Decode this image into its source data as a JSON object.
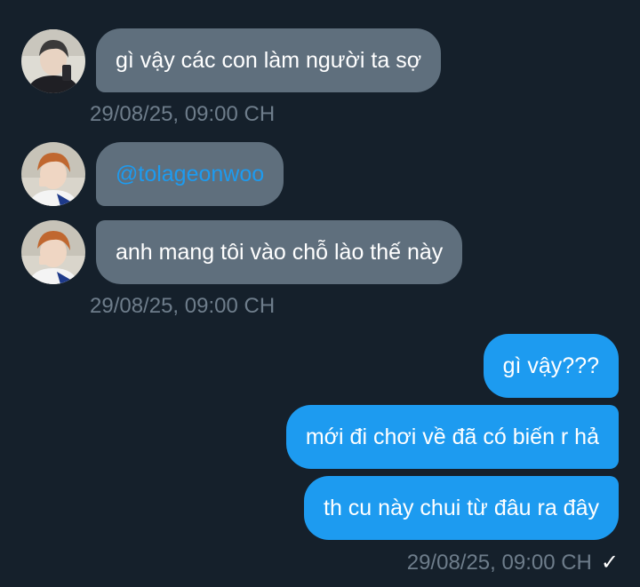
{
  "messages_in_1": {
    "text": "gì vậy các con làm người ta sợ",
    "timestamp": "29/08/25, 09:00 CH"
  },
  "messages_in_2": {
    "mention": "@tolageonwoo",
    "text": "anh mang tôi vào chỗ lào thế này",
    "timestamp": "29/08/25, 09:00 CH"
  },
  "messages_out": {
    "items": [
      "gì vậy???",
      "mới đi chơi về đã có biến r hả",
      "th cu này chui từ đâu ra đây"
    ],
    "timestamp": "29/08/25, 09:00 CH",
    "read_icon": "checkmark-icon"
  },
  "colors": {
    "background": "#15202b",
    "incoming_bubble": "#5f6f7d",
    "outgoing_bubble": "#1d9bf0",
    "mention": "#1d9bf0",
    "timestamp": "#6e7d8b"
  }
}
